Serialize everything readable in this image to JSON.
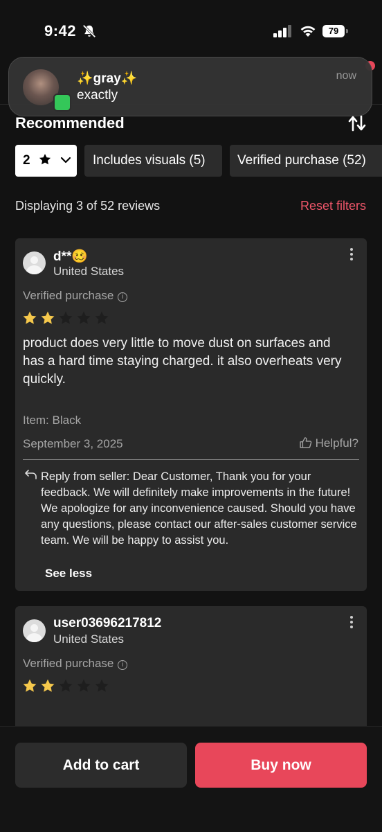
{
  "status_bar": {
    "time": "9:42",
    "battery": "79"
  },
  "notification": {
    "title": "✨gray✨",
    "body": "exactly",
    "time": "now"
  },
  "sort": {
    "label": "Recommended"
  },
  "filters": {
    "rating": "2",
    "visuals": "Includes visuals (5)",
    "verified": "Verified purchase (52)"
  },
  "summary": {
    "displaying": "Displaying 3 of 52 reviews",
    "reset": "Reset filters"
  },
  "reviews": [
    {
      "username": "d**🥴",
      "country": "United States",
      "verified": "Verified purchase",
      "rating": 2,
      "text": "product does very little to move dust on surfaces and has a hard time staying charged. it also overheats very quickly.",
      "item": "Item: Black",
      "date": "September 3, 2025",
      "helpful": "Helpful?",
      "reply": "Reply from seller: Dear Customer, Thank you for your feedback. We will definitely make improvements in the future! We apologize for any inconvenience caused. Should you have any questions, please contact our after-sales customer service team. We will be happy to assist you.",
      "see_less": "See less"
    },
    {
      "username": "user03696217812",
      "country": "United States",
      "verified": "Verified purchase",
      "rating": 2
    }
  ],
  "actions": {
    "add_to_cart": "Add to cart",
    "buy_now": "Buy now"
  },
  "colors": {
    "accent": "#e8475a",
    "star_filled": "#f5c84c",
    "star_empty": "#1e1e1e"
  }
}
